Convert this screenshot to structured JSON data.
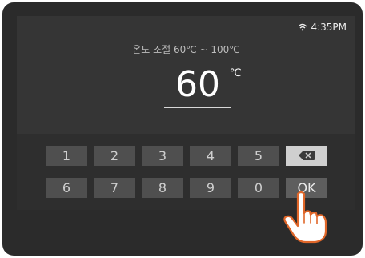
{
  "status": {
    "wifi_icon": "wifi-icon",
    "time": "4:35PM"
  },
  "display": {
    "range_label": "온도 조절 60℃ ~ 100℃",
    "value": "60",
    "unit": "℃"
  },
  "keypad": {
    "row1": [
      "1",
      "2",
      "3",
      "4",
      "5"
    ],
    "row2": [
      "6",
      "7",
      "8",
      "9",
      "0"
    ],
    "backspace_icon": "backspace-icon",
    "ok_label": "OK"
  },
  "pointer": {
    "icon": "hand-pointer-icon"
  },
  "colors": {
    "bezel": "#2b2b2b",
    "display": "#353535",
    "key": "#4f4f4f",
    "backspace_key": "#cfcfcf"
  }
}
